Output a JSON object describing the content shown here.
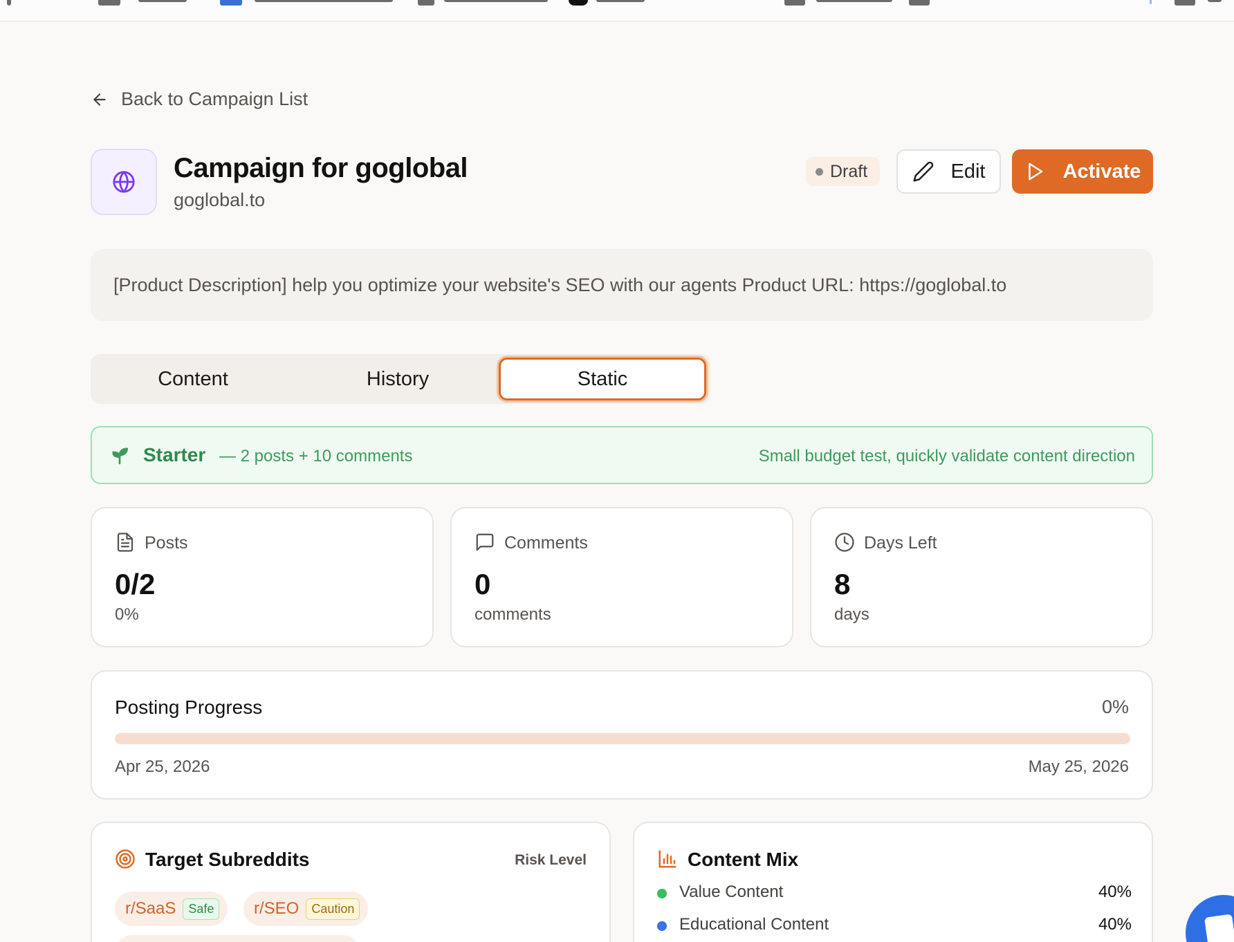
{
  "nav": {
    "back_label": "Back to Campaign List"
  },
  "campaign": {
    "title": "Campaign for goglobal",
    "domain": "goglobal.to",
    "status": "Draft",
    "description": "[Product Description] help you optimize your website's SEO with our agents Product URL: https://goglobal.to"
  },
  "actions": {
    "edit_label": "Edit",
    "activate_label": "Activate"
  },
  "tabs": [
    {
      "label": "Content",
      "active": false
    },
    {
      "label": "History",
      "active": false
    },
    {
      "label": "Static",
      "active": true
    }
  ],
  "plan": {
    "name": "Starter",
    "detail": "— 2 posts + 10 comments",
    "note": "Small budget test, quickly validate content direction"
  },
  "stats": {
    "posts": {
      "label": "Posts",
      "value": "0/2",
      "sub": "0%"
    },
    "comments": {
      "label": "Comments",
      "value": "0",
      "sub": "comments"
    },
    "days": {
      "label": "Days Left",
      "value": "8",
      "sub": "days"
    }
  },
  "progress": {
    "title": "Posting Progress",
    "percent_label": "0%",
    "percent": 0,
    "start_date": "Apr 25, 2026",
    "end_date": "May 25, 2026"
  },
  "subreddits": {
    "title": "Target Subreddits",
    "risk_header": "Risk Level",
    "items": [
      {
        "name": "r/SaaS",
        "risk": "Safe"
      },
      {
        "name": "r/SEO",
        "risk": "Caution"
      }
    ]
  },
  "content_mix": {
    "title": "Content Mix",
    "items": [
      {
        "label": "Value Content",
        "value": "40%",
        "color": "#3bbf5c"
      },
      {
        "label": "Educational Content",
        "value": "40%",
        "color": "#3b73e0"
      }
    ]
  },
  "colors": {
    "accent": "#de6a25",
    "success": "#2f8a4a",
    "caution": "#9c6d0a",
    "globe": "#7c3aed"
  }
}
